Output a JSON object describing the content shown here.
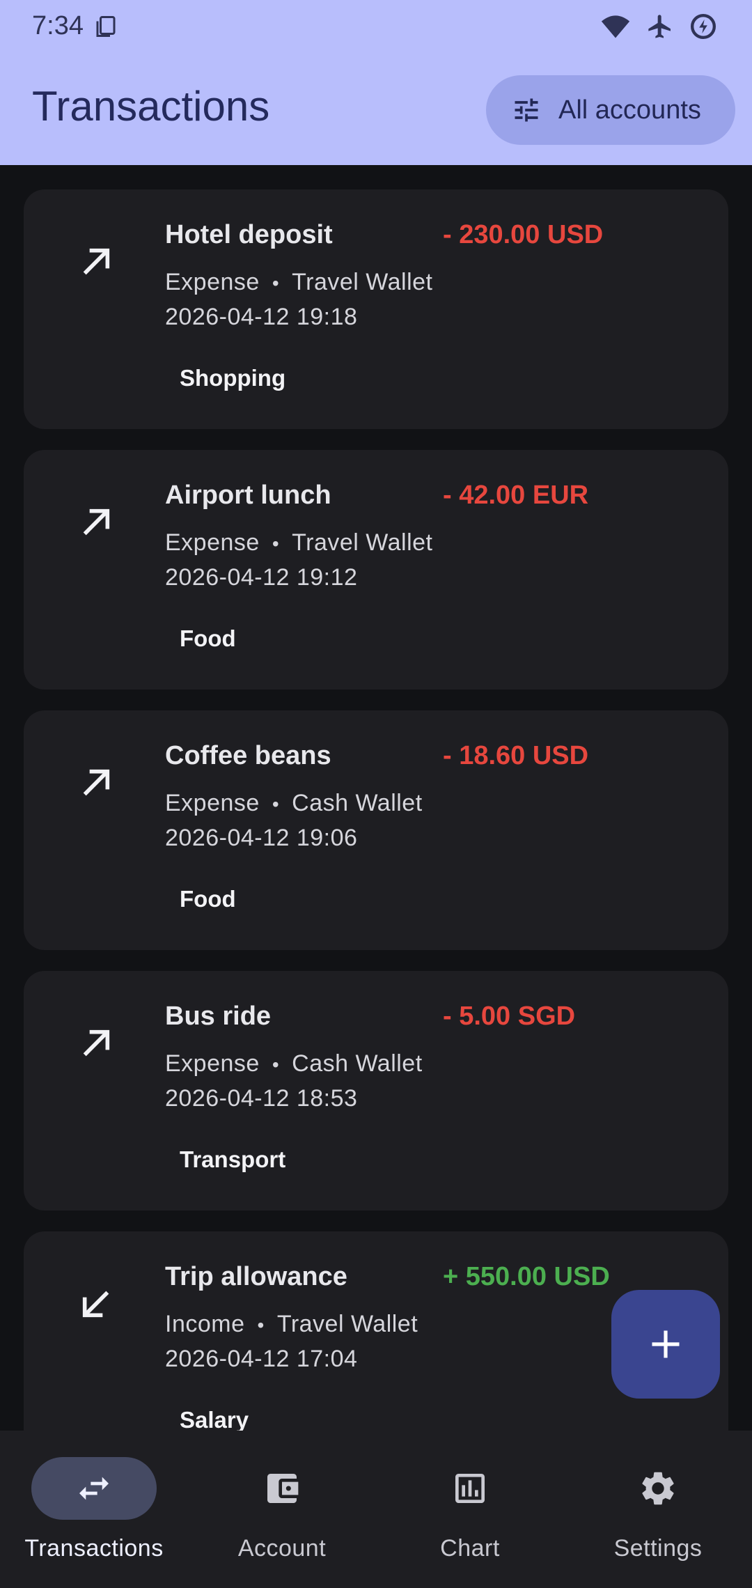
{
  "status_bar": {
    "time": "7:34"
  },
  "header": {
    "title": "Transactions",
    "filter_label": "All accounts"
  },
  "transactions": [
    {
      "title": "Hotel deposit",
      "amount": "- 230.00 USD",
      "type": "Expense",
      "account": "Travel Wallet",
      "datetime": "2026-04-12 19:18",
      "category": "Shopping",
      "direction": "expense"
    },
    {
      "title": "Airport lunch",
      "amount": "- 42.00 EUR",
      "type": "Expense",
      "account": "Travel Wallet",
      "datetime": "2026-04-12 19:12",
      "category": "Food",
      "direction": "expense"
    },
    {
      "title": "Coffee beans",
      "amount": "- 18.60 USD",
      "type": "Expense",
      "account": "Cash Wallet",
      "datetime": "2026-04-12 19:06",
      "category": "Food",
      "direction": "expense"
    },
    {
      "title": "Bus ride",
      "amount": "- 5.00 SGD",
      "type": "Expense",
      "account": "Cash Wallet",
      "datetime": "2026-04-12 18:53",
      "category": "Transport",
      "direction": "expense"
    },
    {
      "title": "Trip allowance",
      "amount": "+ 550.00 USD",
      "type": "Income",
      "account": "Travel Wallet",
      "datetime": "2026-04-12 17:04",
      "category": "Salary",
      "direction": "income"
    }
  ],
  "meta_separator": "•",
  "nav": {
    "items": [
      {
        "label": "Transactions",
        "icon": "swap-icon",
        "active": true
      },
      {
        "label": "Account",
        "icon": "wallet-icon",
        "active": false
      },
      {
        "label": "Chart",
        "icon": "chart-icon",
        "active": false
      },
      {
        "label": "Settings",
        "icon": "gear-icon",
        "active": false
      }
    ]
  },
  "colors": {
    "header_bg": "#b8befc",
    "expense": "#e7473e",
    "income": "#4caf50",
    "card_bg": "#1e1e22",
    "fab_bg": "#3a4590"
  }
}
